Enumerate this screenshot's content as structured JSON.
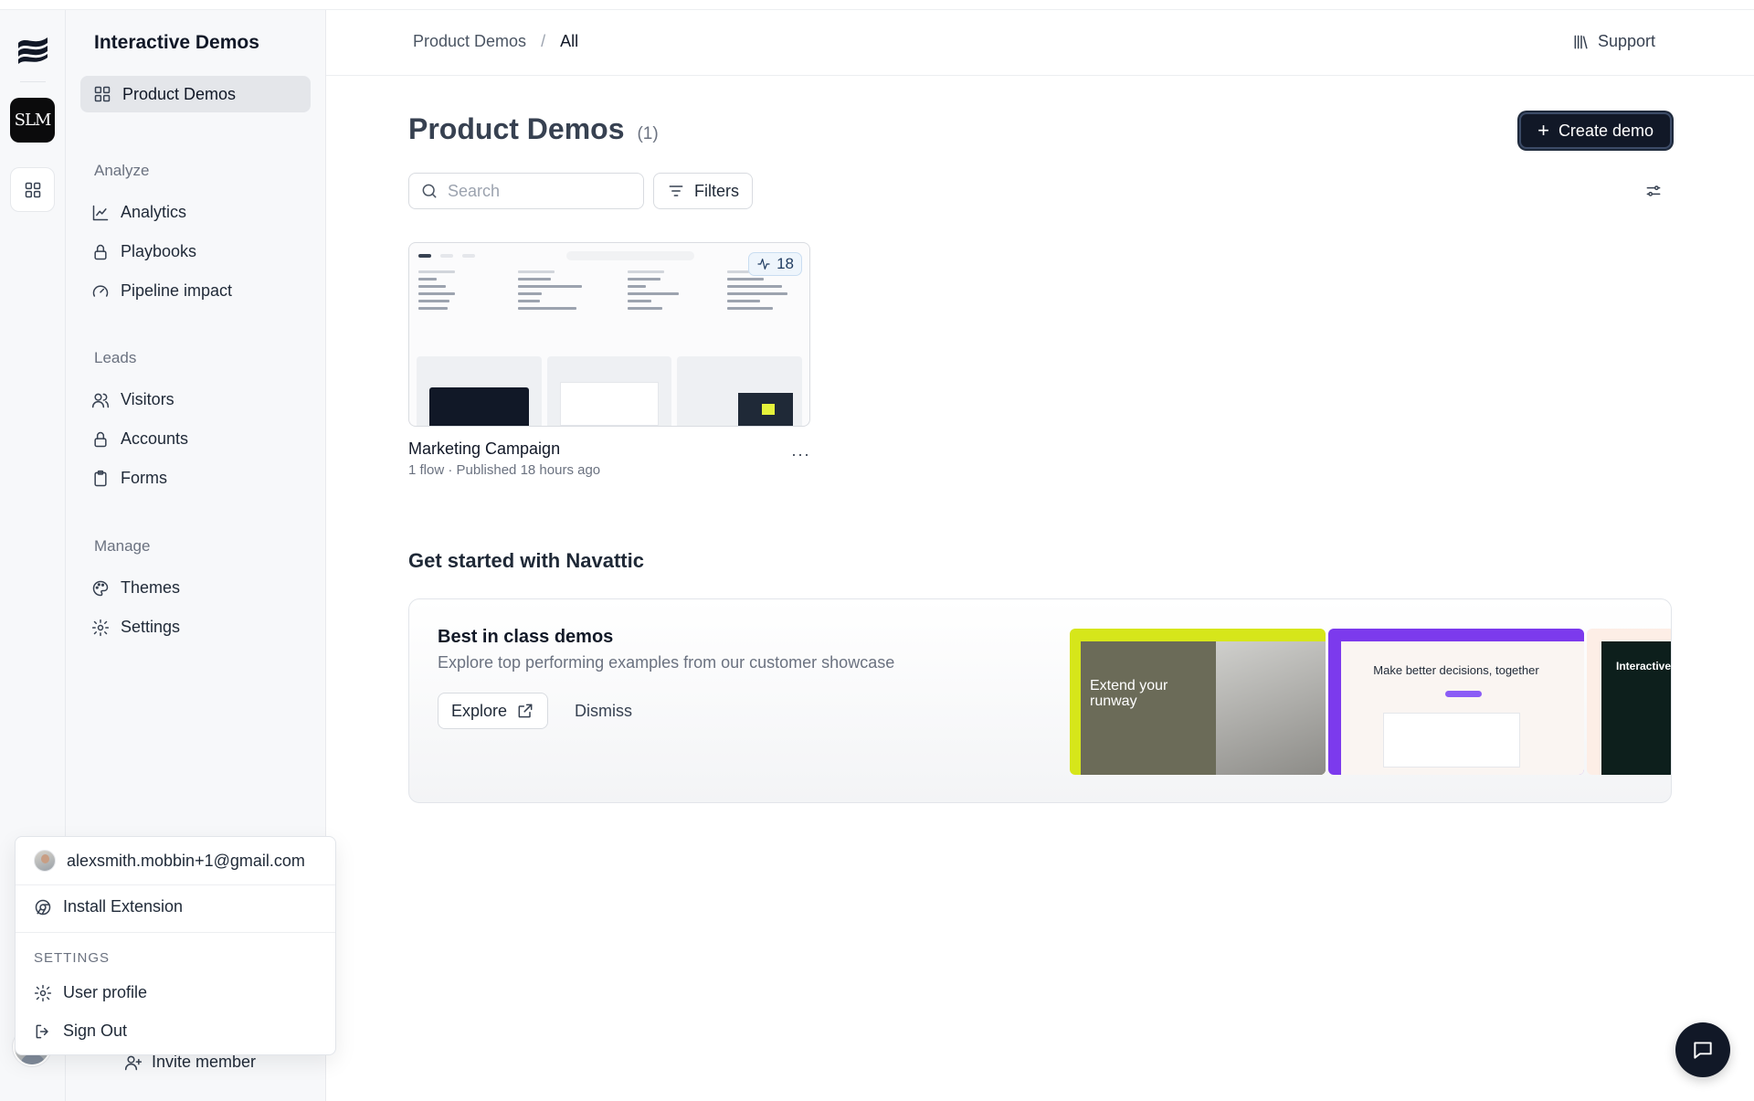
{
  "rail": {
    "workspace_initials": "SLM"
  },
  "sidebar": {
    "title": "Interactive Demos",
    "active_item": "Product Demos",
    "sections": {
      "analyze": "Analyze",
      "leads": "Leads",
      "manage": "Manage"
    },
    "items": {
      "analytics": "Analytics",
      "playbooks": "Playbooks",
      "pipeline": "Pipeline impact",
      "visitors": "Visitors",
      "accounts": "Accounts",
      "forms": "Forms",
      "themes": "Themes",
      "settings": "Settings"
    },
    "invite": "Invite member"
  },
  "header": {
    "breadcrumb_root": "Product Demos",
    "breadcrumb_sep": "/",
    "breadcrumb_current": "All",
    "support": "Support"
  },
  "main": {
    "title": "Product Demos",
    "count": "(1)",
    "create_button": "Create demo",
    "search_placeholder": "Search",
    "filters": "Filters",
    "demos": [
      {
        "name": "Marketing Campaign",
        "meta": "1 flow · Published 18 hours ago",
        "activity_count": "18",
        "more": "···"
      }
    ]
  },
  "get_started": {
    "title": "Get started with Navattic",
    "card_title": "Best in class demos",
    "card_subtitle": "Explore top performing examples from our customer showcase",
    "explore": "Explore",
    "dismiss": "Dismiss",
    "showcase": [
      {
        "headline": "Extend your runway",
        "accent": "#d6e61a"
      },
      {
        "headline": "Make better decisions, together",
        "accent": "#7c3aed"
      },
      {
        "headline": "Interactive",
        "accent": "#0d1f1c"
      }
    ]
  },
  "account_menu": {
    "email": "alexsmith.mobbin+1@gmail.com",
    "install_extension": "Install Extension",
    "settings_label": "SETTINGS",
    "user_profile": "User profile",
    "sign_out": "Sign Out"
  },
  "colors": {
    "primary_button": "#111827",
    "sidebar_bg": "#f7f8fa",
    "active_item_bg": "#e4e6ea",
    "badge_bg": "#eef5fc"
  }
}
